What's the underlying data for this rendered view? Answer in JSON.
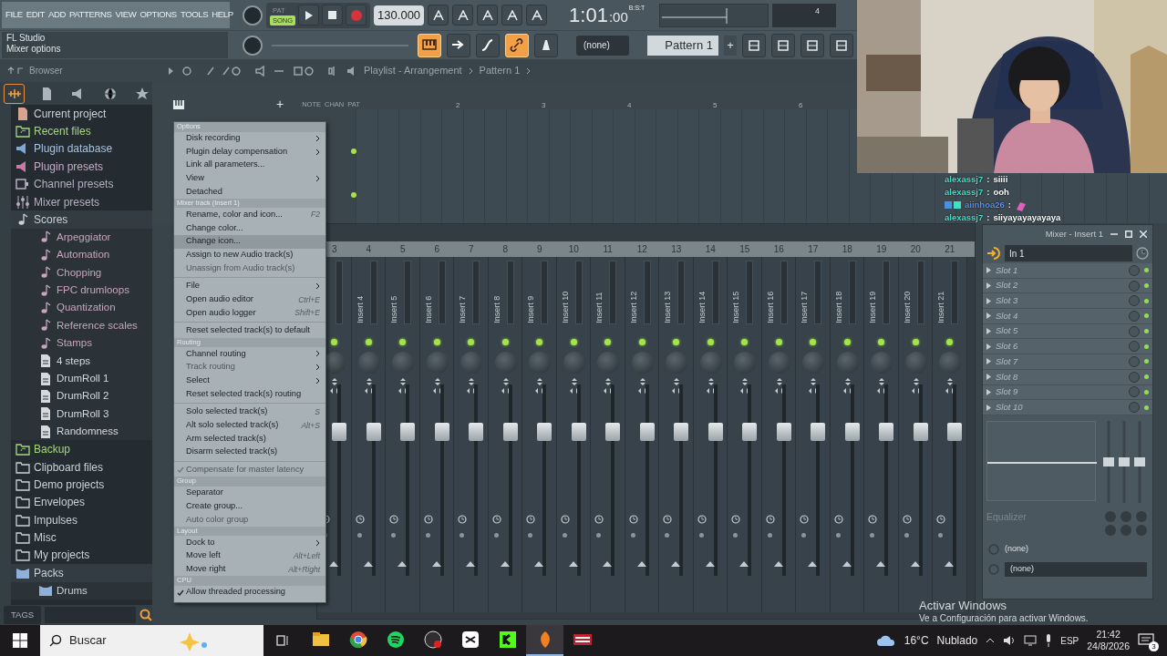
{
  "menu_bar": [
    "FILE",
    "EDIT",
    "ADD",
    "PATTERNS",
    "VIEW",
    "OPTIONS",
    "TOOLS",
    "HELP"
  ],
  "hint_panel": {
    "title": "FL Studio",
    "text": "Mixer options"
  },
  "transport": {
    "modes": [
      {
        "label": "PAT",
        "selected": false
      },
      {
        "label": "SONG",
        "selected": true
      }
    ],
    "recording": false,
    "tempo": "130.000",
    "time": "1:01",
    "time_ticks": ":00",
    "time_unit": "B:S:T",
    "meter_value": "4"
  },
  "tool_buttons": [
    {
      "kind": "piano",
      "on": true
    },
    {
      "kind": "arrow",
      "on": false
    },
    {
      "kind": "curve",
      "on": false
    },
    {
      "kind": "link",
      "on": true
    },
    {
      "kind": "metronome",
      "on": false
    }
  ],
  "pattern": {
    "channel": "(none)",
    "name": "Pattern 1",
    "add": "+"
  },
  "browser": {
    "title": "Browser",
    "tabs": [
      {
        "kind": "all",
        "selected": true
      },
      {
        "kind": "files",
        "selected": false
      },
      {
        "kind": "plugins",
        "selected": false
      },
      {
        "kind": "web",
        "selected": false
      },
      {
        "kind": "star",
        "selected": false
      }
    ],
    "items": [
      {
        "label": "Current project",
        "kind": "project",
        "color": "#c9d2d8"
      },
      {
        "label": "Recent files",
        "kind": "recent",
        "color": "#a6d77f"
      },
      {
        "label": "Plugin database",
        "kind": "plugin-db",
        "color": "#a9c2e0"
      },
      {
        "label": "Plugin presets",
        "kind": "plugin-presets",
        "color": "#c7a9c6"
      },
      {
        "label": "Channel presets",
        "kind": "channel-presets",
        "color": "#b9adc4"
      },
      {
        "label": "Mixer presets",
        "kind": "mixer-presets",
        "color": "#b9adc4"
      },
      {
        "label": "Scores",
        "kind": "note",
        "color": "#c9d2d8",
        "children": [
          {
            "label": "Arpeggiator",
            "kind": "note",
            "color": "#c7a4bf"
          },
          {
            "label": "Automation",
            "kind": "note",
            "color": "#c7a4bf"
          },
          {
            "label": "Chopping",
            "kind": "note",
            "color": "#c7a4bf"
          },
          {
            "label": "FPC drumloops",
            "kind": "note",
            "color": "#c7a4bf"
          },
          {
            "label": "Quantization",
            "kind": "note",
            "color": "#c7a4bf"
          },
          {
            "label": "Reference scales",
            "kind": "note",
            "color": "#c7a4bf"
          },
          {
            "label": "Stamps",
            "kind": "note",
            "color": "#c7a4bf"
          },
          {
            "label": "4 steps",
            "kind": "file",
            "color": "#d3d9dd"
          },
          {
            "label": "DrumRoll 1",
            "kind": "file",
            "color": "#d3d9dd"
          },
          {
            "label": "DrumRoll 2",
            "kind": "file",
            "color": "#d3d9dd"
          },
          {
            "label": "DrumRoll 3",
            "kind": "file",
            "color": "#d3d9dd"
          },
          {
            "label": "Randomness",
            "kind": "file",
            "color": "#d3d9dd"
          }
        ]
      },
      {
        "label": "Backup",
        "kind": "recent",
        "color": "#a6d77f"
      },
      {
        "label": "Clipboard files",
        "kind": "folder",
        "color": "#c9d2d8"
      },
      {
        "label": "Demo projects",
        "kind": "folder",
        "color": "#c9d2d8"
      },
      {
        "label": "Envelopes",
        "kind": "folder",
        "color": "#c9d2d8"
      },
      {
        "label": "Impulses",
        "kind": "folder",
        "color": "#c9d2d8"
      },
      {
        "label": "Misc",
        "kind": "folder",
        "color": "#c9d2d8"
      },
      {
        "label": "My projects",
        "kind": "folder",
        "color": "#c9d2d8"
      },
      {
        "label": "Packs",
        "kind": "pack",
        "color": "#c9d2d8",
        "children": [
          {
            "label": "Drums",
            "kind": "pack",
            "color": "#c9d2d8"
          }
        ]
      }
    ],
    "tags": "TAGS"
  },
  "playlist": {
    "title": "Playlist - Arrangement",
    "pattern": "Pattern 1",
    "bars": [
      "2",
      "3",
      "4",
      "5",
      "6"
    ],
    "tool_labels": [
      "NOTE",
      "CHAN",
      "PAT"
    ],
    "add_track": "+"
  },
  "context_menu": [
    {
      "header": "Options",
      "items": [
        {
          "kind": "item",
          "label": "Disk recording",
          "submenu": true
        },
        {
          "kind": "item",
          "label": "Plugin delay compensation",
          "submenu": true
        },
        {
          "kind": "item",
          "label": "Link all parameters..."
        },
        {
          "kind": "item",
          "label": "View",
          "submenu": true
        },
        {
          "kind": "item",
          "label": "Detached"
        }
      ]
    },
    {
      "header": "Mixer track (Insert 1)",
      "items": [
        {
          "kind": "item",
          "label": "Rename, color and icon...",
          "shortcut": "F2"
        },
        {
          "kind": "item",
          "label": "Change color..."
        },
        {
          "kind": "item",
          "label": "Change icon...",
          "selected": true
        },
        {
          "kind": "item",
          "label": "Assign to new Audio track(s)"
        },
        {
          "kind": "item",
          "label": "Unassign from Audio track(s)",
          "disabled": true
        },
        {
          "kind": "divider"
        },
        {
          "kind": "item",
          "label": "File",
          "submenu": true
        },
        {
          "kind": "item",
          "label": "Open audio editor",
          "shortcut": "Ctrl+E"
        },
        {
          "kind": "item",
          "label": "Open audio logger",
          "shortcut": "Shift+E"
        },
        {
          "kind": "divider"
        },
        {
          "kind": "item",
          "label": "Reset selected track(s) to default"
        }
      ]
    },
    {
      "header": "Routing",
      "items": [
        {
          "kind": "item",
          "label": "Channel routing",
          "submenu": true
        },
        {
          "kind": "item",
          "label": "Track routing",
          "submenu": true,
          "disabled": true
        },
        {
          "kind": "item",
          "label": "Select",
          "submenu": true
        },
        {
          "kind": "item",
          "label": "Reset selected track(s) routing"
        },
        {
          "kind": "divider"
        },
        {
          "kind": "item",
          "label": "Solo selected track(s)",
          "shortcut": "S"
        },
        {
          "kind": "item",
          "label": "Alt solo selected track(s)",
          "shortcut": "Alt+S"
        },
        {
          "kind": "item",
          "label": "Arm selected track(s)"
        },
        {
          "kind": "item",
          "label": "Disarm selected track(s)"
        },
        {
          "kind": "divider"
        },
        {
          "kind": "item",
          "label": "Compensate for master latency",
          "disabled": true,
          "checked": true
        }
      ]
    },
    {
      "header": "Group",
      "items": [
        {
          "kind": "item",
          "label": "Separator"
        },
        {
          "kind": "item",
          "label": "Create group..."
        },
        {
          "kind": "item",
          "label": "Auto color group",
          "disabled": true
        }
      ]
    },
    {
      "header": "Layout",
      "items": [
        {
          "kind": "item",
          "label": "Dock to",
          "submenu": true
        },
        {
          "kind": "item",
          "label": "Move left",
          "shortcut": "Alt+Left"
        },
        {
          "kind": "item",
          "label": "Move right",
          "shortcut": "Alt+Right"
        }
      ]
    },
    {
      "header": "CPU",
      "items": [
        {
          "kind": "item",
          "label": "Allow threaded processing",
          "checked": true
        }
      ]
    }
  ],
  "mixer": {
    "tracks": [
      {
        "number": "3",
        "on": true,
        "level": 0.78
      },
      {
        "number": "4",
        "name": "Insert 4",
        "on": true,
        "level": 0.78
      },
      {
        "number": "5",
        "name": "Insert 5",
        "on": true,
        "level": 0.78
      },
      {
        "number": "6",
        "name": "Insert 6",
        "on": true,
        "level": 0.78
      },
      {
        "number": "7",
        "name": "Insert 7",
        "on": true,
        "level": 0.78
      },
      {
        "number": "8",
        "name": "Insert 8",
        "on": true,
        "level": 0.78
      },
      {
        "number": "9",
        "name": "Insert 9",
        "on": true,
        "level": 0.78
      },
      {
        "number": "10",
        "name": "Insert 10",
        "on": true,
        "level": 0.78
      },
      {
        "number": "11",
        "name": "Insert 11",
        "on": true,
        "level": 0.78
      },
      {
        "number": "12",
        "name": "Insert 12",
        "on": true,
        "level": 0.78
      },
      {
        "number": "13",
        "name": "Insert 13",
        "on": true,
        "level": 0.78
      },
      {
        "number": "14",
        "name": "Insert 14",
        "on": true,
        "level": 0.78
      },
      {
        "number": "15",
        "name": "Insert 15",
        "on": true,
        "level": 0.78
      },
      {
        "number": "16",
        "name": "Insert 16",
        "on": true,
        "level": 0.78
      },
      {
        "number": "17",
        "name": "Insert 17",
        "on": true,
        "level": 0.78
      },
      {
        "number": "18",
        "name": "Insert 18",
        "on": true,
        "level": 0.78
      },
      {
        "number": "19",
        "name": "Insert 19",
        "on": true,
        "level": 0.78
      },
      {
        "number": "20",
        "name": "Insert 20",
        "on": true,
        "level": 0.78
      },
      {
        "number": "21",
        "name": "Insert 21",
        "on": true,
        "level": 0.78
      }
    ]
  },
  "insert_window": {
    "title": "Mixer - Insert 1",
    "input": "In 1",
    "slots": [
      {
        "label": "Slot 1",
        "on": true
      },
      {
        "label": "Slot 2",
        "on": true
      },
      {
        "label": "Slot 3",
        "on": true
      },
      {
        "label": "Slot 4",
        "on": true
      },
      {
        "label": "Slot 5",
        "on": true
      },
      {
        "label": "Slot 6",
        "on": true
      },
      {
        "label": "Slot 7",
        "on": true
      },
      {
        "label": "Slot 8",
        "on": true
      },
      {
        "label": "Slot 9",
        "on": true
      },
      {
        "label": "Slot 10",
        "on": true
      }
    ],
    "eq_label": "Equalizer",
    "routes": [
      "(none)",
      "(none)"
    ]
  },
  "chat": [
    {
      "user": "alexassj7",
      "separator": ":",
      "text": "siiii",
      "color": "#3fe0c8"
    },
    {
      "user": "alexassj7",
      "separator": ":",
      "text": "ooh",
      "color": "#3fe0c8"
    },
    {
      "user": "aiinhoa26",
      "separator": ":",
      "sticker": true,
      "color": "#5b8ff0"
    },
    {
      "user": "alexassj7",
      "separator": ":",
      "text": "siiyayayayayaya",
      "color": "#3fe0c8"
    }
  ],
  "activation_notice": {
    "title": "Activar Windows",
    "text": "Ve a Configuración para activar Windows."
  },
  "taskbar": {
    "search": "Buscar",
    "apps": [
      {
        "kind": "files",
        "active": false
      },
      {
        "kind": "browser",
        "active": false
      },
      {
        "kind": "music",
        "active": false
      },
      {
        "kind": "recorder",
        "active": false
      },
      {
        "kind": "editor",
        "active": false
      },
      {
        "kind": "k",
        "active": false
      },
      {
        "kind": "daw",
        "active": true
      },
      {
        "kind": "mixer",
        "active": false
      }
    ],
    "temperature": "16°C",
    "weather": "Nublado",
    "language": "ESP",
    "time": "21:42",
    "date": "24/8/2026",
    "notifications": "3"
  }
}
